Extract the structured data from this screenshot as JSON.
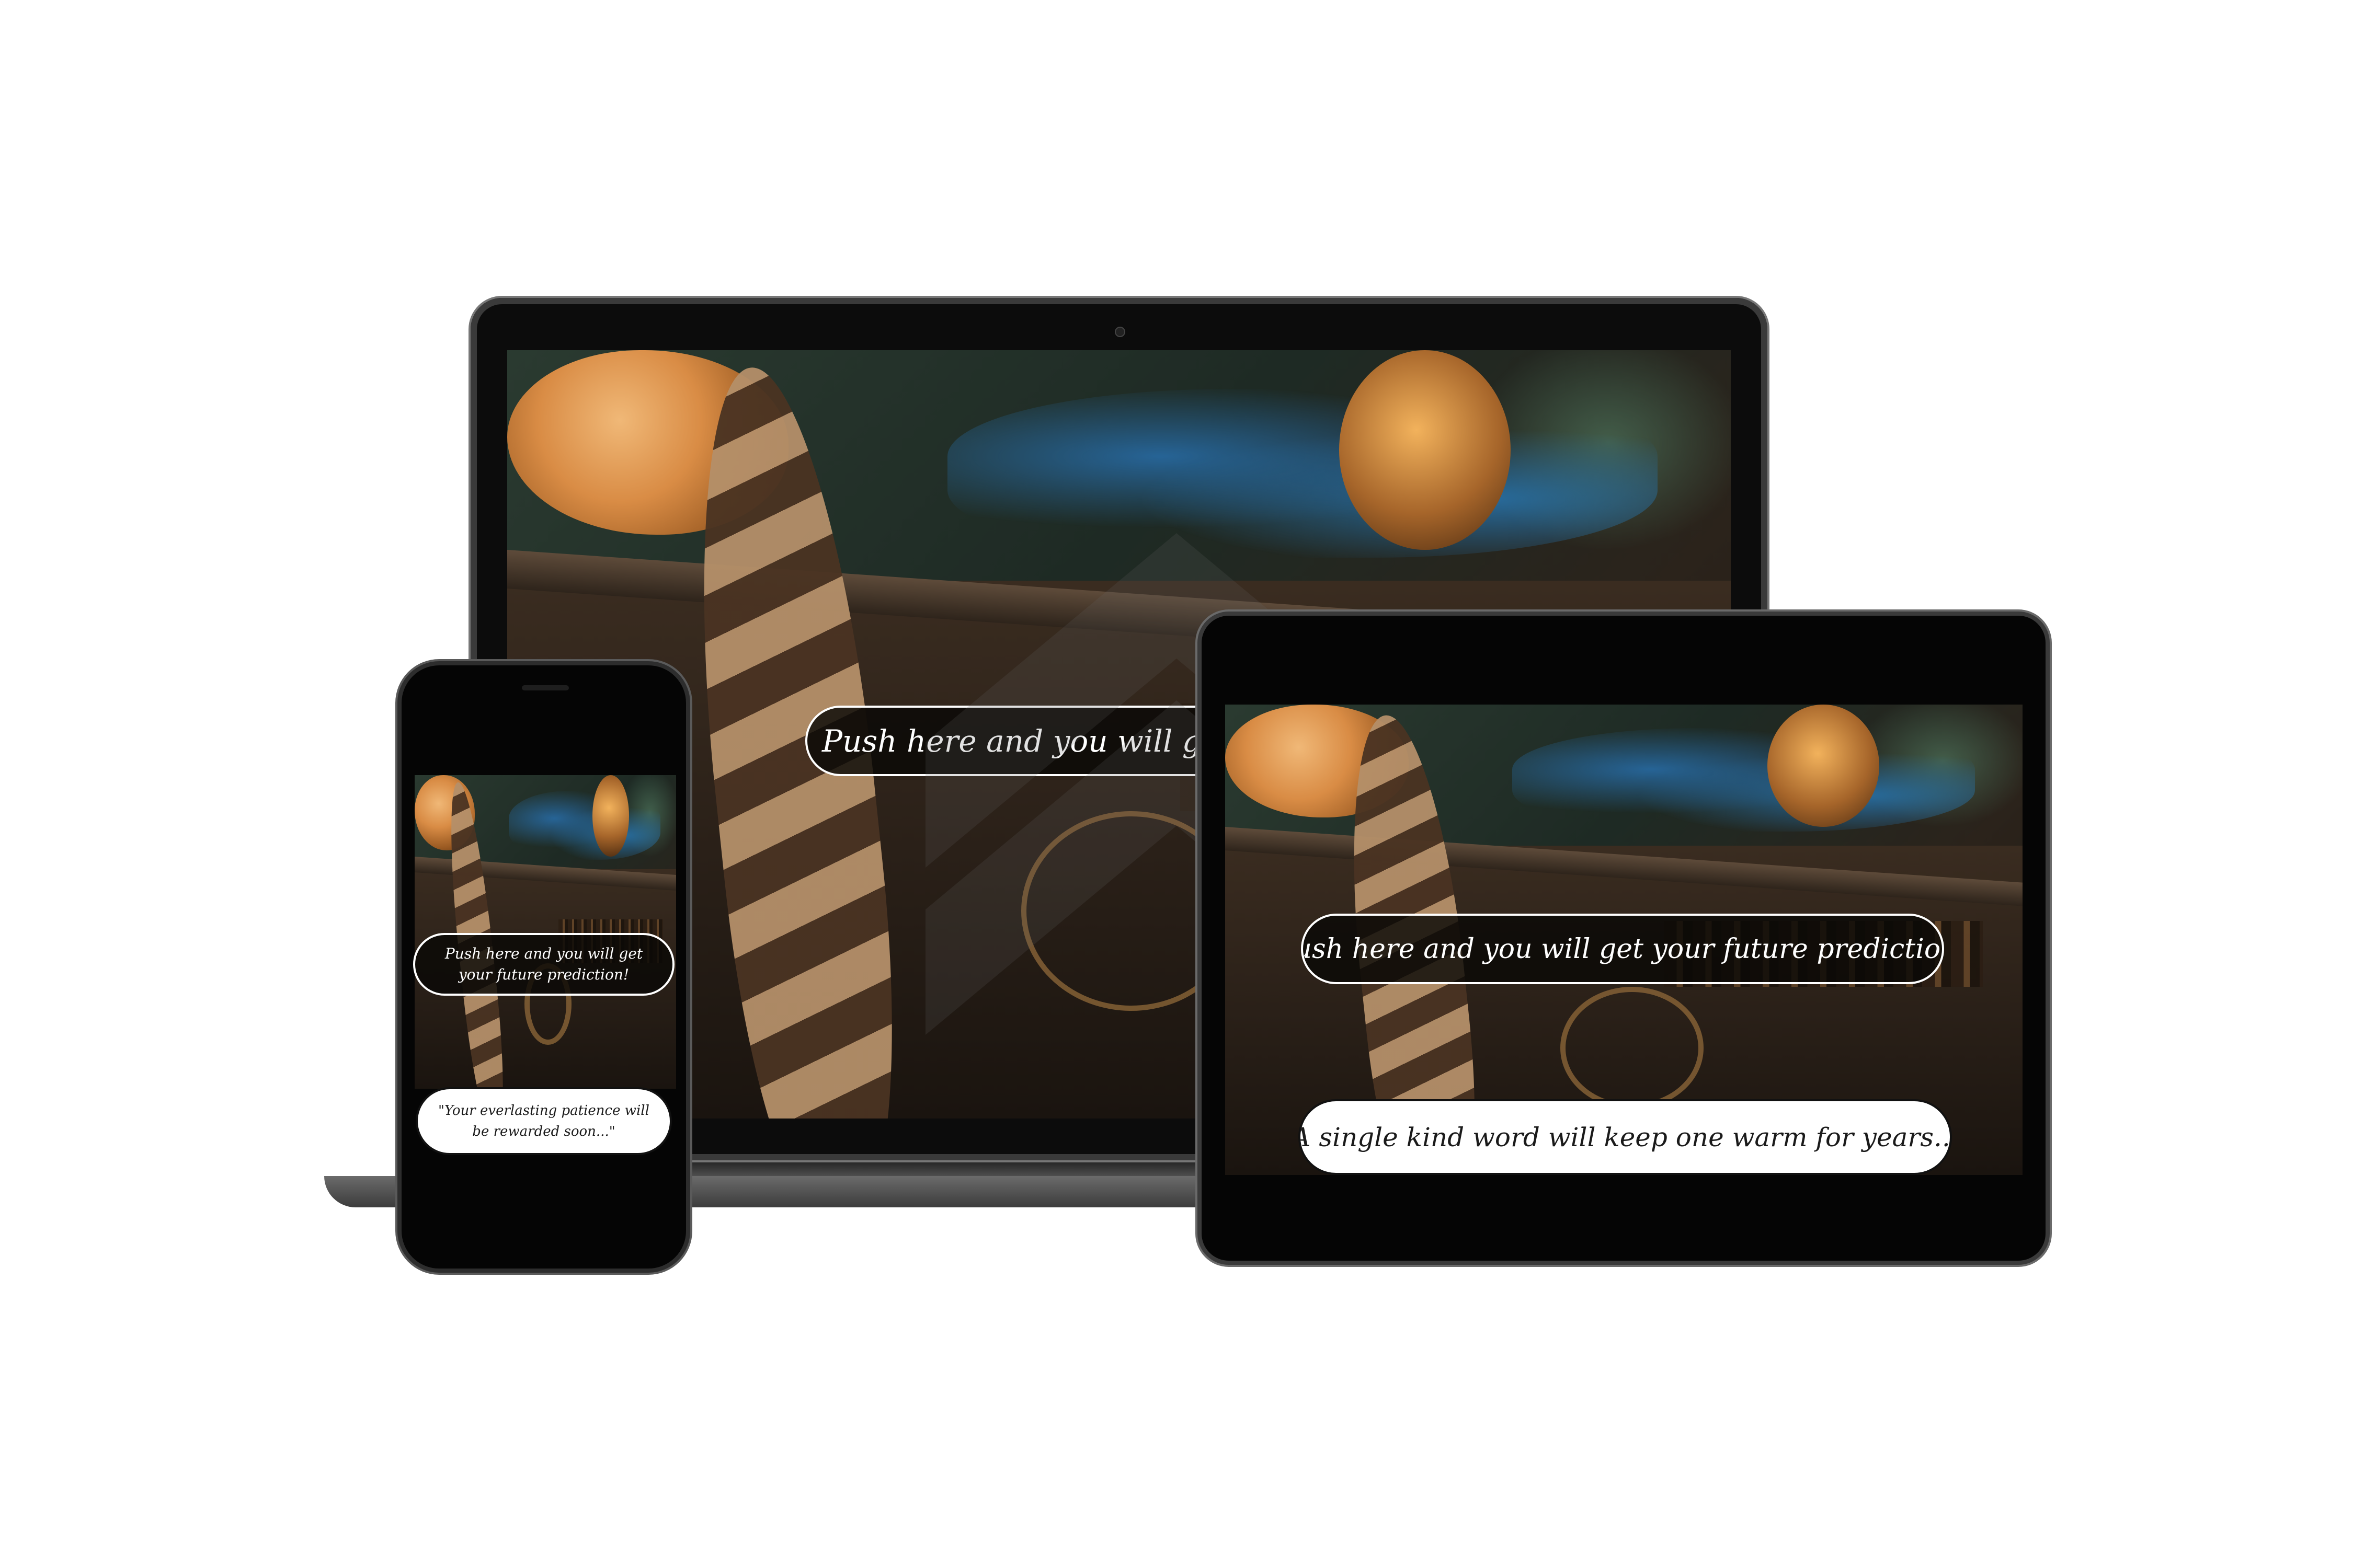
{
  "app": {
    "prompt_text": "Push here and you will get your future prediction!",
    "laptop_prompt_visible": "Push here and you will get your"
  },
  "phone": {
    "prompt_text": "Push here and you will get your future prediction!",
    "prediction_text": "\"Your everlasting patience will be rewarded soon...\""
  },
  "tablet": {
    "prompt_text": "Push here and you will get your future prediction!",
    "prediction_text": "\"A single kind word will keep one warm for years...\""
  },
  "colors": {
    "pill_dark_bg": "#0a0806",
    "pill_light_bg": "#ffffff",
    "device_frame": "#2d2d2d",
    "background": "#ffffff"
  }
}
